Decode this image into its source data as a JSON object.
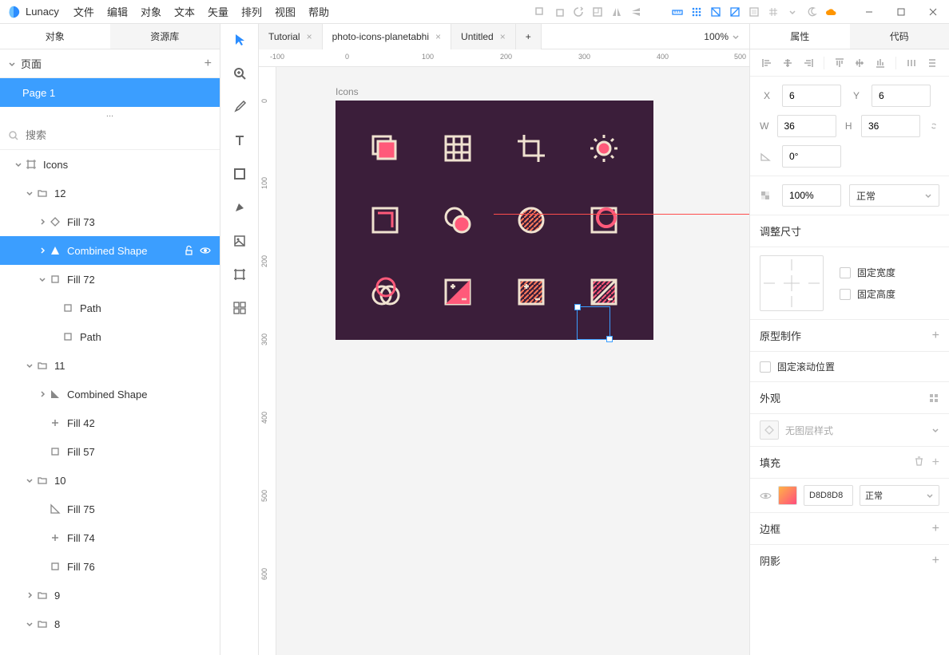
{
  "app": {
    "name": "Lunacy"
  },
  "menu": [
    "文件",
    "编辑",
    "对象",
    "文本",
    "矢量",
    "排列",
    "视图",
    "帮助"
  ],
  "left_tabs": {
    "objects": "对象",
    "library": "资源库"
  },
  "pages": {
    "title": "页面",
    "items": [
      "Page 1"
    ],
    "dots": "..."
  },
  "search": {
    "placeholder": "搜索"
  },
  "layers": [
    {
      "label": "Icons",
      "type": "artboard",
      "indent": 0,
      "expanded": true
    },
    {
      "label": "12",
      "type": "folder",
      "indent": 1,
      "expanded": true
    },
    {
      "label": "Fill 73",
      "type": "shape",
      "indent": 2,
      "expanded": false,
      "icon": "diamond"
    },
    {
      "label": "Combined Shape",
      "type": "shape",
      "indent": 2,
      "expanded": false,
      "selected": true,
      "icon": "shape"
    },
    {
      "label": "Fill 72",
      "type": "shape",
      "indent": 2,
      "expanded": true,
      "icon": "rect"
    },
    {
      "label": "Path",
      "type": "path",
      "indent": 3,
      "icon": "rect"
    },
    {
      "label": "Path",
      "type": "path",
      "indent": 3,
      "icon": "rect"
    },
    {
      "label": "11",
      "type": "folder",
      "indent": 1,
      "expanded": true
    },
    {
      "label": "Combined Shape",
      "type": "shape",
      "indent": 2,
      "icon": "triangle"
    },
    {
      "label": "Fill 42",
      "type": "shape",
      "indent": 2,
      "icon": "plus"
    },
    {
      "label": "Fill 57",
      "type": "shape",
      "indent": 2,
      "icon": "rect"
    },
    {
      "label": "10",
      "type": "folder",
      "indent": 1,
      "expanded": true
    },
    {
      "label": "Fill 75",
      "type": "shape",
      "indent": 2,
      "icon": "triangle-outline"
    },
    {
      "label": "Fill 74",
      "type": "shape",
      "indent": 2,
      "icon": "plus"
    },
    {
      "label": "Fill 76",
      "type": "shape",
      "indent": 2,
      "icon": "rect"
    },
    {
      "label": "9",
      "type": "folder",
      "indent": 1,
      "expanded": false
    },
    {
      "label": "8",
      "type": "folder",
      "indent": 1,
      "expanded": true
    }
  ],
  "doc_tabs": [
    {
      "label": "Tutorial",
      "active": false
    },
    {
      "label": "photo-icons-planetabhi",
      "active": true
    },
    {
      "label": "Untitled",
      "active": false
    }
  ],
  "zoom": "100%",
  "ruler_top": [
    "-100",
    "0",
    "100",
    "200",
    "300",
    "400",
    "500"
  ],
  "ruler_left": [
    "0",
    "100",
    "200",
    "300",
    "400",
    "500",
    "600"
  ],
  "artboard": {
    "label": "Icons"
  },
  "right_tabs": {
    "props": "属性",
    "code": "代码"
  },
  "props": {
    "x_label": "X",
    "x": "6",
    "y_label": "Y",
    "y": "6",
    "w_label": "W",
    "w": "36",
    "h_label": "H",
    "h": "36",
    "rotation": "0°",
    "opacity": "100%",
    "blend": "正常"
  },
  "sections": {
    "resize": "调整尺寸",
    "fix_width": "固定宽度",
    "fix_height": "固定高度",
    "prototype": "原型制作",
    "fix_scroll": "固定滚动位置",
    "appearance": "外观",
    "no_layer_style": "无图层样式",
    "fill": "填充",
    "fill_hex": "D8D8D8",
    "fill_blend": "正常",
    "border": "边框",
    "shadow": "阴影"
  }
}
